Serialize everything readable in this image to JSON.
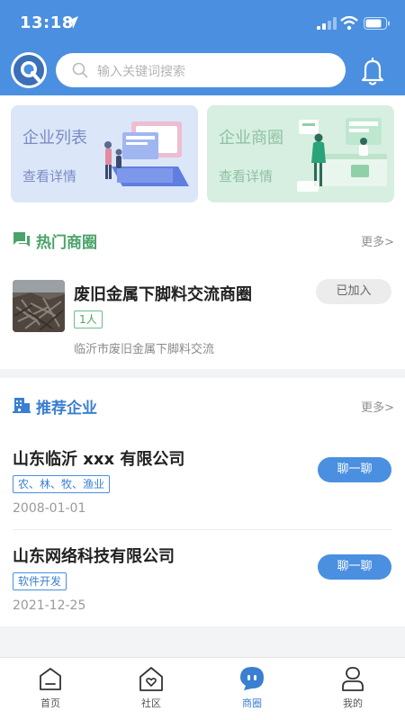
{
  "status_bar": {
    "time": "13:18"
  },
  "header": {
    "search_placeholder": "输入关键词搜索",
    "icons": [
      "app-logo-icon",
      "search-icon",
      "bell-icon"
    ]
  },
  "cards": [
    {
      "title": "企业列表",
      "subtitle": "查看详情"
    },
    {
      "title": "企业商圈",
      "subtitle": "查看详情"
    }
  ],
  "hot_circles": {
    "title": "热门商圈",
    "more": "更多>",
    "items": [
      {
        "name": "废旧金属下脚料交流商圈",
        "members": "1人",
        "description": "临沂市废旧金属下脚料交流",
        "action": "已加入"
      }
    ]
  },
  "recommended": {
    "title": "推荐企业",
    "more": "更多>",
    "items": [
      {
        "name": "山东临沂 xxx 有限公司",
        "tag": "农、林、牧、渔业",
        "date": "2008-01-01",
        "action": "聊一聊"
      },
      {
        "name": "山东网络科技有限公司",
        "tag": "软件开发",
        "date": "2021-12-25",
        "action": "聊一聊"
      }
    ]
  },
  "tabbar": {
    "active": "商圈",
    "tabs": [
      {
        "label": "首页",
        "icon": "home-icon"
      },
      {
        "label": "社区",
        "icon": "community-icon"
      },
      {
        "label": "商圈",
        "icon": "chat-bubble-icon"
      },
      {
        "label": "我的",
        "icon": "profile-icon"
      }
    ]
  },
  "colors": {
    "primary": "#4a8fe0",
    "green": "#4aa368"
  }
}
